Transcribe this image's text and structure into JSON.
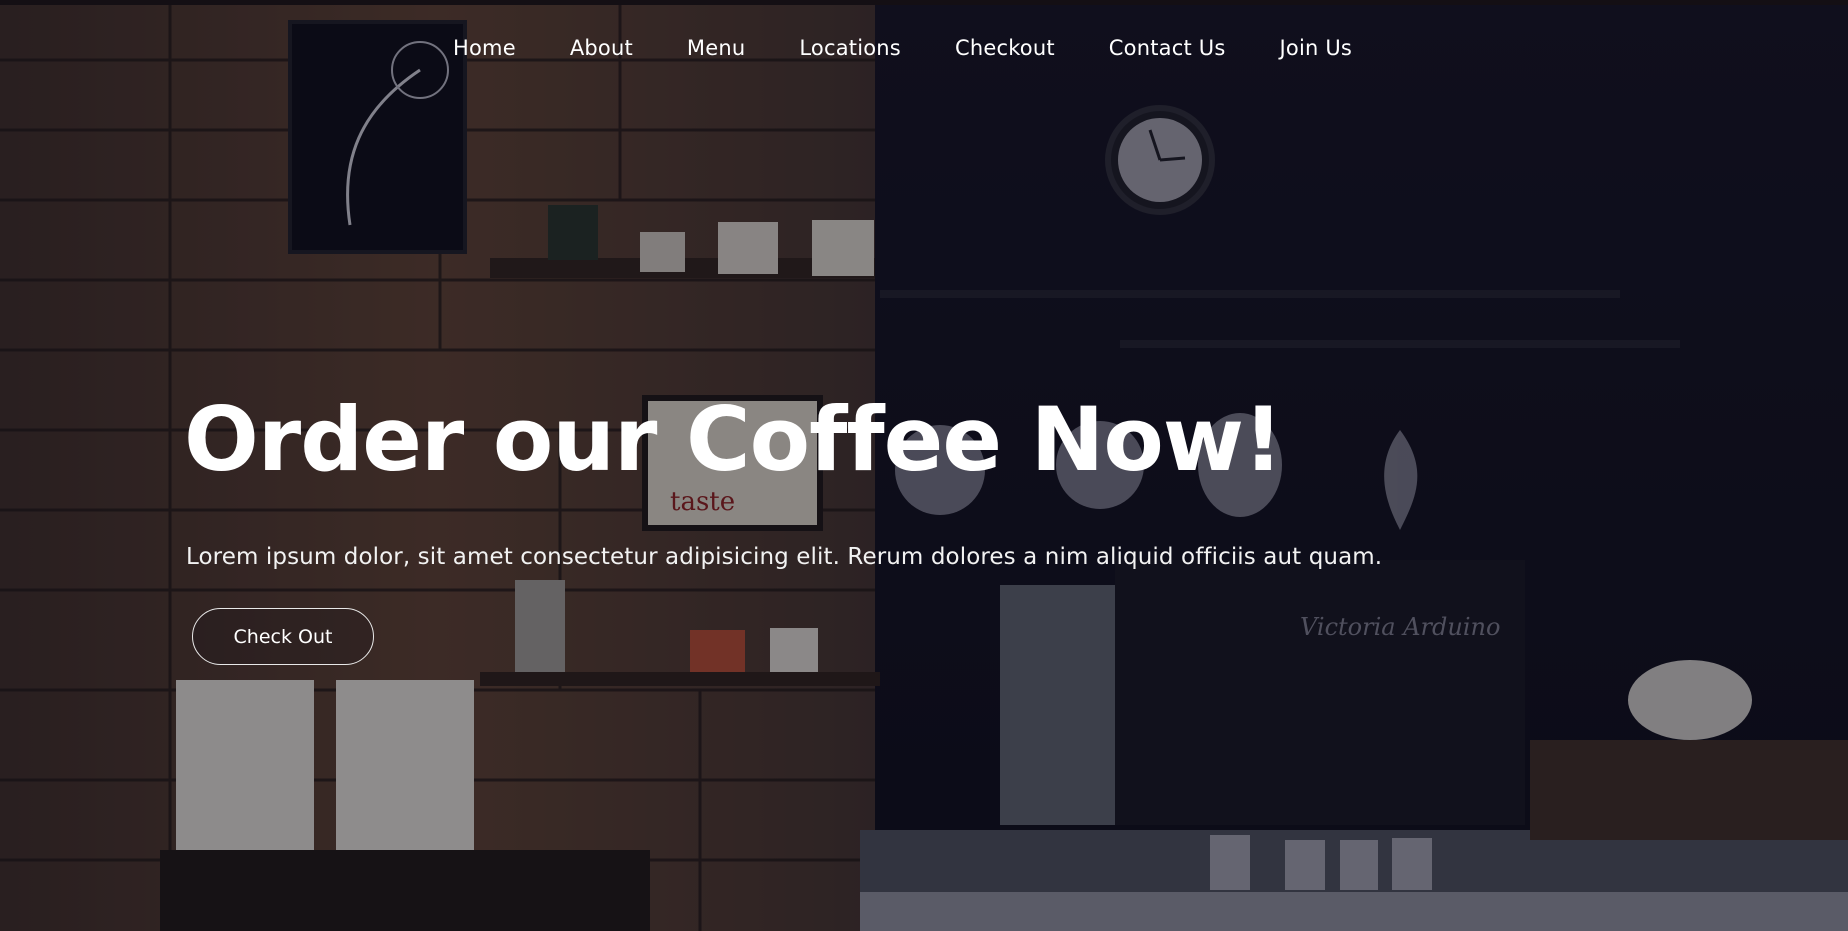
{
  "nav": {
    "items": [
      {
        "label": "Home"
      },
      {
        "label": "About"
      },
      {
        "label": "Menu"
      },
      {
        "label": "Locations"
      },
      {
        "label": "Checkout"
      },
      {
        "label": "Contact Us"
      },
      {
        "label": "Join Us"
      }
    ]
  },
  "hero": {
    "title": "Order our Coffee Now!",
    "subtitle": "Lorem ipsum dolor, sit amet consectetur adipisicing elit. Rerum dolores a nim aliquid officiis aut quam.",
    "cta_label": "Check Out"
  },
  "colors": {
    "overlay": "#0d0c1a",
    "wood_light": "#5a3e2b",
    "wood_dark": "#2b1d16",
    "text": "#ffffff"
  }
}
